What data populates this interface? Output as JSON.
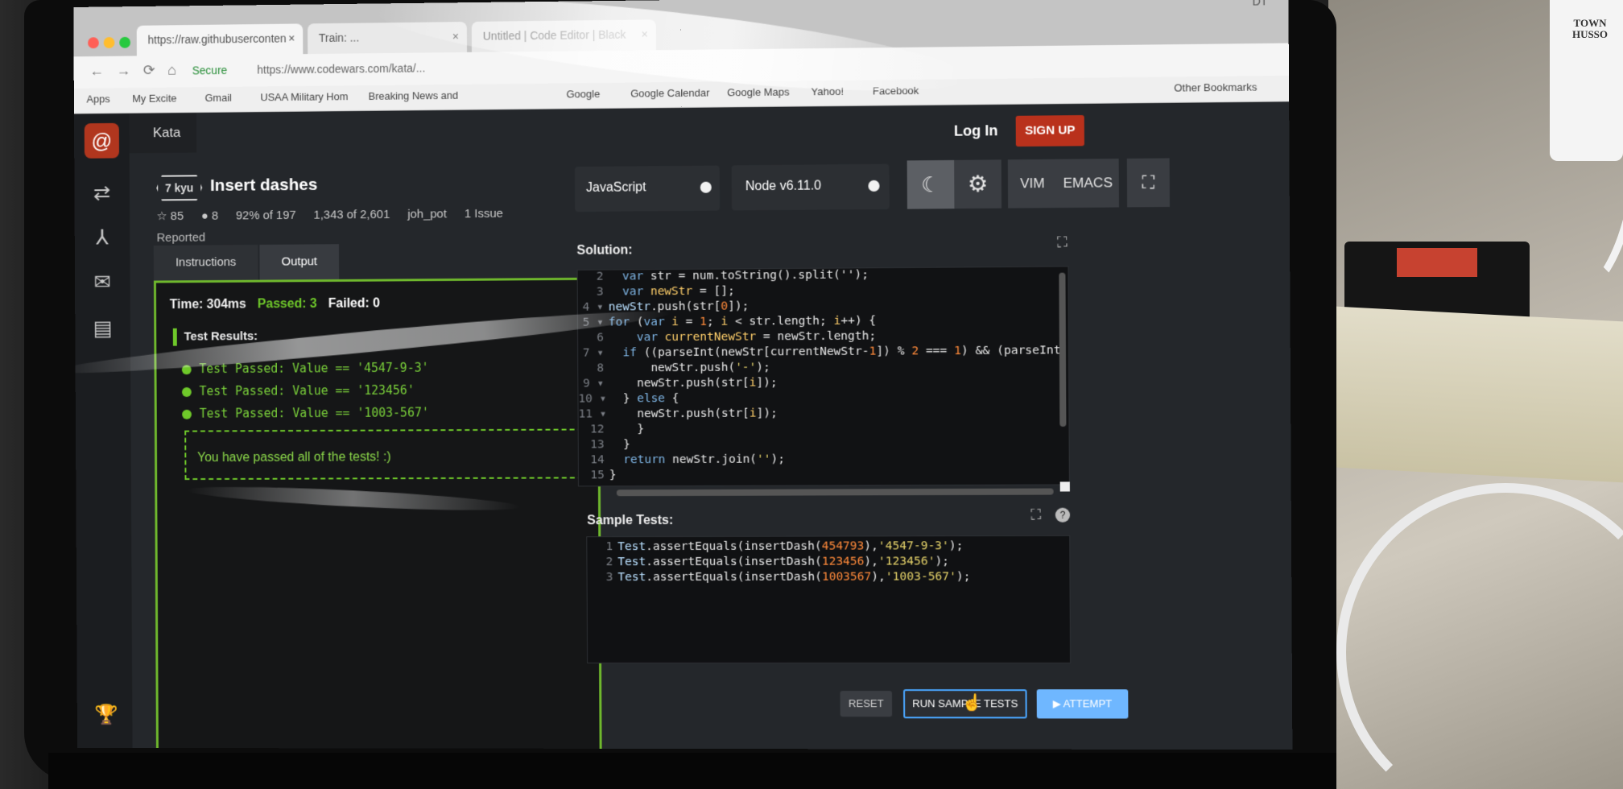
{
  "browser": {
    "tabs": [
      {
        "label": "https://raw.githubuserconten",
        "close": "×"
      },
      {
        "label": "Train: ...",
        "close": "×"
      },
      {
        "label": "Untitled | Code Editor | Black",
        "close": "×"
      }
    ],
    "secure_label": "Secure",
    "url": "https://www.codewars.com/kata/...",
    "bookmarks": [
      "Apps",
      "My Excite",
      "Gmail",
      "USAA Military Hom",
      "Breaking News and",
      "Google",
      "Google Calendar",
      "Google Maps",
      "Yahoo!",
      "Facebook",
      "Other Bookmarks"
    ]
  },
  "app": {
    "logo": "@",
    "kata_label": "Kata",
    "login": "Log In",
    "signup": "SIGN UP",
    "kyu": "7 kyu",
    "title": "Insert dashes",
    "stats": {
      "stars": "☆ 85",
      "bookmarks": "● 8",
      "satisfaction": "92% of 197",
      "completed": "1,343 of 2,601",
      "author": "joh_pot",
      "issues": "1 Issue"
    },
    "reported": "Reported",
    "language": "JavaScript",
    "node_version": "Node v6.11.0",
    "modes": {
      "vim": "VIM",
      "emacs": "EMACS"
    },
    "icons": {
      "moon": "☾",
      "gear": "⚙",
      "fullscreen": "⛶",
      "trophy": "🏆"
    }
  },
  "tabs": {
    "instructions": "Instructions",
    "output": "Output"
  },
  "output": {
    "time": "Time: 304ms",
    "passed": "Passed: 3",
    "failed": "Failed: 0",
    "results_title": "Test Results:",
    "results": [
      "Test Passed: Value == '4547-9-3'",
      "Test Passed: Value == '123456'",
      "Test Passed: Value == '1003-567'"
    ],
    "summary": "You have passed all of the tests! :)"
  },
  "solution": {
    "label": "Solution:"
  },
  "sample_tests": {
    "label": "Sample Tests:"
  },
  "buttons": {
    "reset": "RESET",
    "run": "RUN SAMPLE TESTS",
    "attempt": "▶ ATTEMPT"
  },
  "clock": "DT",
  "mug_text": "TOWN\nHUSSO"
}
